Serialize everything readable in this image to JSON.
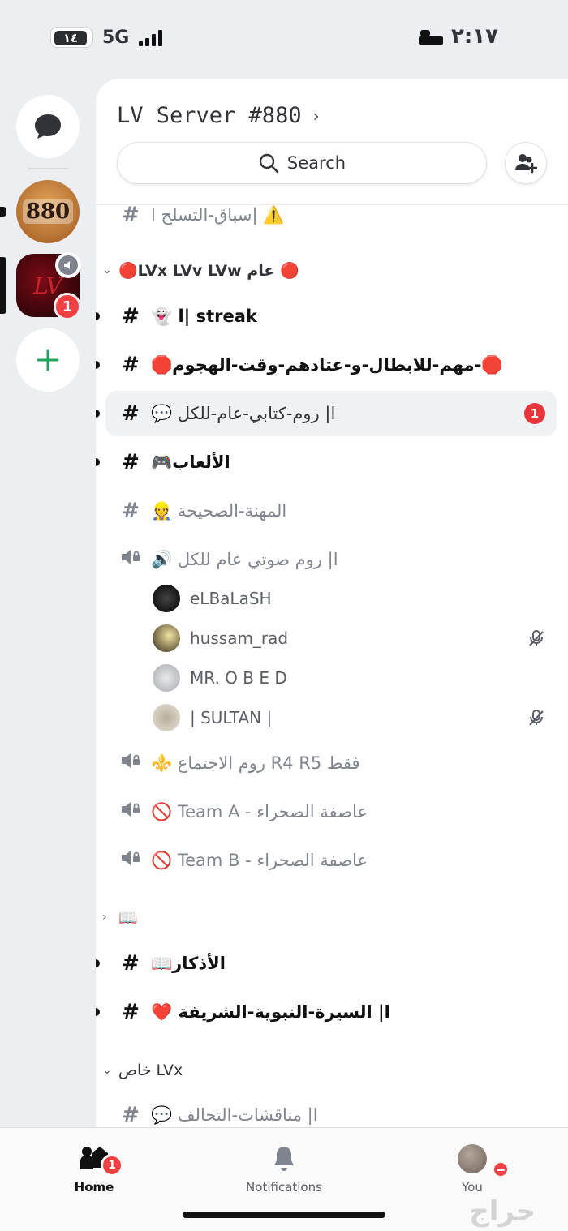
{
  "status_bar": {
    "battery": "١٤",
    "network": "5G",
    "time": "٢:١٧"
  },
  "rail": {
    "server_880_label": "880",
    "server_lv_label": "LV",
    "server_lv_badge": "1"
  },
  "header": {
    "server_name": "LV Server #880",
    "chevron": "›",
    "search_label": "Search"
  },
  "channels": [
    {
      "type": "text",
      "name": "سباق-التسلح ا| ⚠️",
      "unread": false,
      "partial": true
    },
    {
      "type": "category",
      "name": "🔴LVx LVv LVw عام 🔴",
      "collapsed": false
    },
    {
      "type": "text",
      "name": "👻 l| streak",
      "unread": true
    },
    {
      "type": "text",
      "name": "🛑مهم-للابطال-و-عتادهم-وقت-الهجوم-🛑",
      "unread": true
    },
    {
      "type": "text",
      "name": "💬 ا| روم-كتابي-عام-للكل",
      "unread": true,
      "selected": true,
      "badge": "1"
    },
    {
      "type": "text",
      "name": "🎮الألعاب",
      "unread": true
    },
    {
      "type": "text",
      "name": "👷 المهنة-الصحيحة",
      "unread": false
    },
    {
      "type": "voice",
      "name": "🔊 ا| روم صوتي عام للكل",
      "unread": false
    },
    {
      "type": "voice-user",
      "name": "eLBaLaSH",
      "muted": false
    },
    {
      "type": "voice-user",
      "name": "hussam_rad",
      "muted": true
    },
    {
      "type": "voice-user",
      "name": "MR. O B E D",
      "muted": false
    },
    {
      "type": "voice-user",
      "name": "| SULTAN |",
      "muted": true
    },
    {
      "type": "voice",
      "name": "⚜️ روم الاجتماع R4  R5 فقط",
      "unread": false
    },
    {
      "type": "voice",
      "name": "🚫 Team A - عاصفة الصحراء",
      "unread": false
    },
    {
      "type": "voice",
      "name": "🚫 Team B - عاصفة الصحراء",
      "unread": false
    },
    {
      "type": "category",
      "name": "📖",
      "collapsed": true
    },
    {
      "type": "text",
      "name": "📖الأذكار",
      "unread": true
    },
    {
      "type": "text",
      "name": "❤️ ا| السيرة-النبوية-الشريفة",
      "unread": true
    },
    {
      "type": "category",
      "name": "خاص LVx",
      "collapsed": false
    },
    {
      "type": "text",
      "name": "💬 ا| مناقشات-التحالف",
      "unread": false,
      "partial": true
    }
  ],
  "bottom_nav": {
    "home_label": "Home",
    "home_badge": "1",
    "notifications_label": "Notifications",
    "you_label": "You"
  },
  "watermark": "حراج",
  "colors": {
    "accent_green": "#23a559",
    "badge_red": "#f23f42"
  }
}
